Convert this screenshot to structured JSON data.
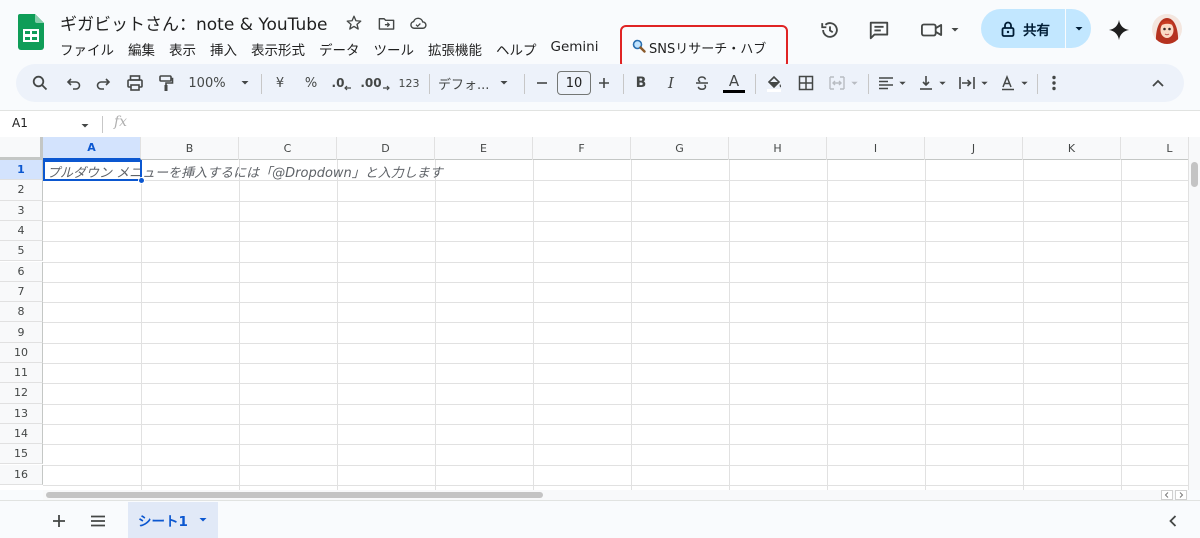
{
  "app": {
    "title": "ギガビットさん：note & YouTube",
    "share_label": "共有",
    "menu": [
      "ファイル",
      "編集",
      "表示",
      "挿入",
      "表示形式",
      "データ",
      "ツール",
      "拡張機能",
      "ヘルプ",
      "Gemini"
    ],
    "custom_menu_label": "SNSリサーチ・ハブ",
    "custom_menu_icon": "magnifier-emoji-icon",
    "highlight_color": "#e02424",
    "accent_color": "#0b57d0",
    "share_color": "#c2e7ff"
  },
  "toolbar": {
    "zoom": "100%",
    "currency": "¥",
    "percent": "%",
    "decrease_decimal": ".0",
    "increase_decimal": ".00",
    "number_format": "123",
    "font_name": "デフォ...",
    "font_size": "10",
    "bold": "B",
    "italic": "I",
    "text_color": "A"
  },
  "formula_bar": {
    "cell_ref": "A1",
    "fx": "fx"
  },
  "grid": {
    "columns": [
      "A",
      "B",
      "C",
      "D",
      "E",
      "F",
      "G",
      "H",
      "I",
      "J",
      "K",
      "L"
    ],
    "rows": [
      "1",
      "2",
      "3",
      "4",
      "5",
      "6",
      "7",
      "8",
      "9",
      "10",
      "11",
      "12",
      "13",
      "14",
      "15",
      "16"
    ],
    "selected_cell": "A1",
    "cell_placeholder": "プルダウン メニューを挿入するには「@Dropdown」と入力します"
  },
  "sheets": {
    "active_sheet": "シート1"
  }
}
